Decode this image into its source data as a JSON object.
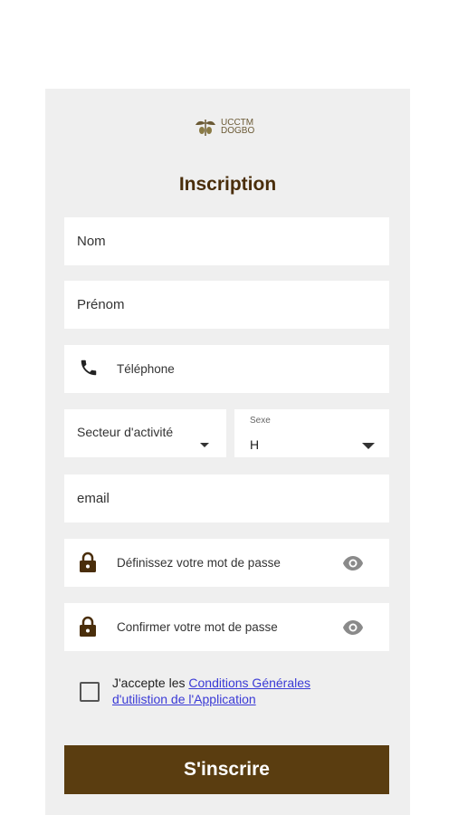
{
  "logo": {
    "line1": "UCCTM",
    "line2": "DOGBO"
  },
  "form": {
    "title": "Inscription",
    "nom_placeholder": "Nom",
    "prenom_placeholder": "Prénom",
    "telephone_placeholder": "Téléphone",
    "secteur_placeholder": "Secteur d'activité",
    "sexe_label": "Sexe",
    "sexe_value": "H",
    "email_placeholder": "email",
    "password_placeholder": "Définissez votre mot de passe",
    "confirm_placeholder": "Confirmer votre mot de passe",
    "terms_prefix": "J'accepte les ",
    "terms_link": "Conditions Générales d'utilistion  de l'Application",
    "submit_label": "S'inscrire"
  },
  "icons": {
    "phone": "phone-icon",
    "lock": "lock-icon",
    "eye": "eye-icon",
    "dropdown": "chevron-down-icon"
  },
  "colors": {
    "brand": "#5a3d10",
    "title": "#4a2e0b",
    "link": "#3a3ad6",
    "card_bg": "#efefef"
  }
}
